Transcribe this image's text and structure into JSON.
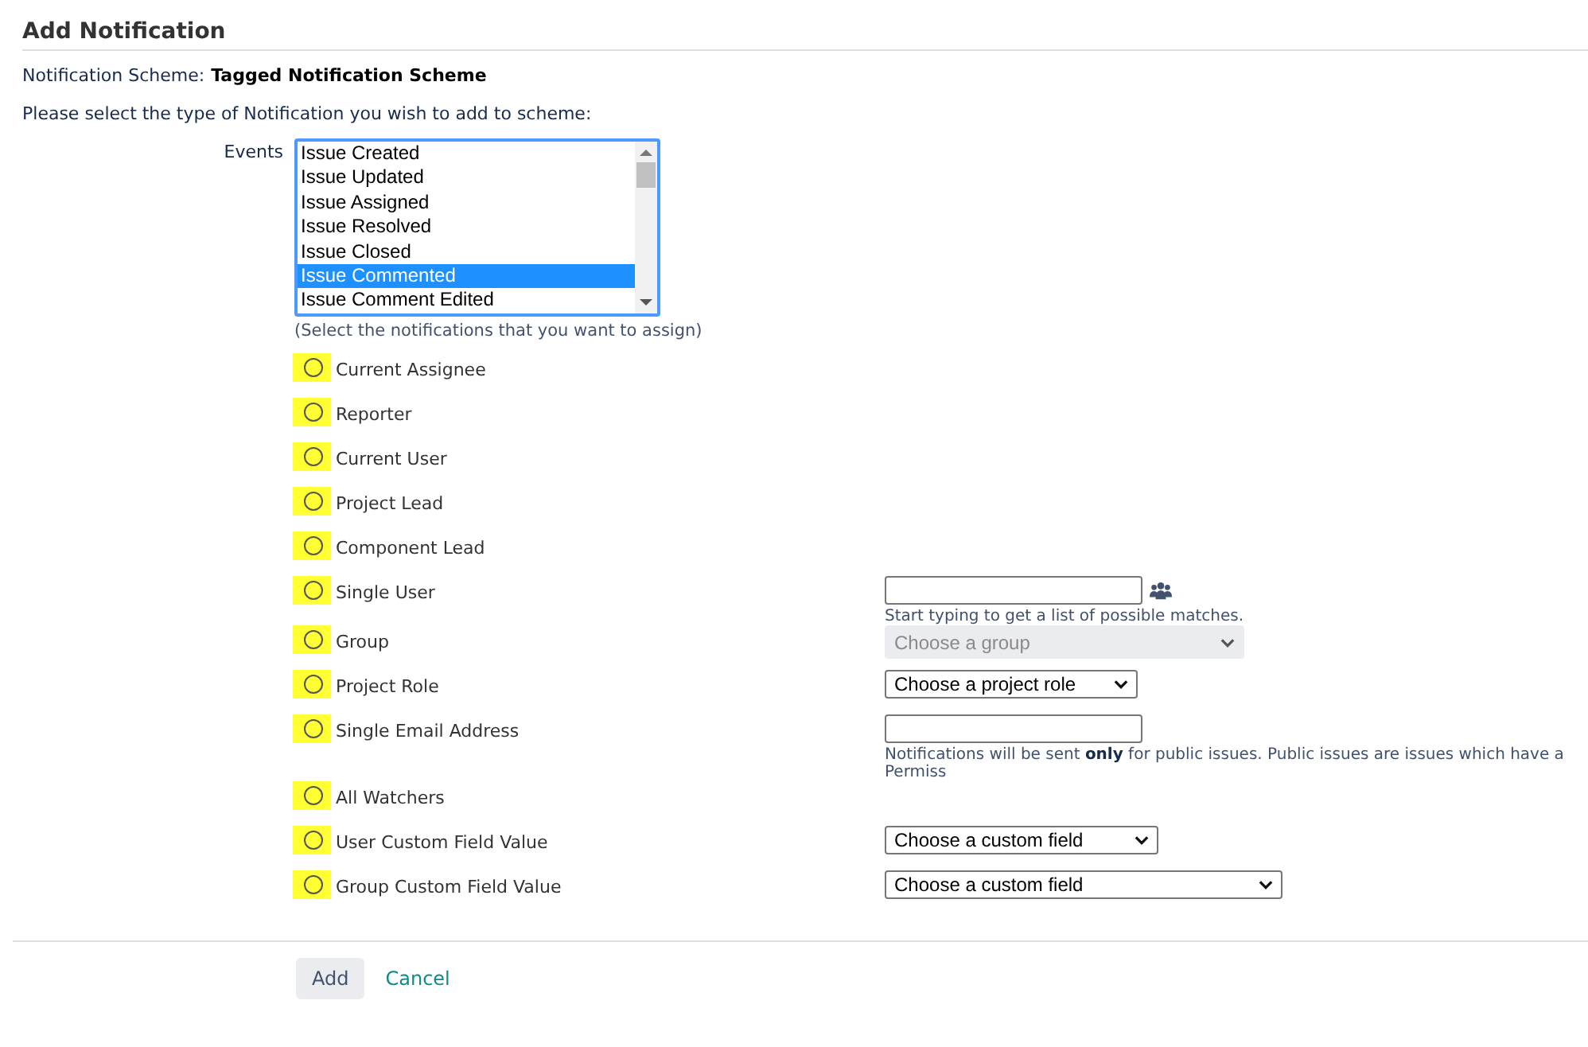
{
  "title": "Add Notification",
  "scheme": {
    "label": "Notification Scheme:",
    "name": "Tagged Notification Scheme"
  },
  "instruction": "Please select the type of Notification you wish to add to scheme:",
  "events": {
    "label": "Events",
    "hint": "(Select the notifications that you want to assign)",
    "items": [
      {
        "label": "Issue Created",
        "selected": false
      },
      {
        "label": "Issue Updated",
        "selected": false
      },
      {
        "label": "Issue Assigned",
        "selected": false
      },
      {
        "label": "Issue Resolved",
        "selected": false
      },
      {
        "label": "Issue Closed",
        "selected": false
      },
      {
        "label": "Issue Commented",
        "selected": true
      },
      {
        "label": "Issue Comment Edited",
        "selected": false
      }
    ]
  },
  "options": [
    {
      "label": "Current Assignee",
      "selected": false,
      "highlighted": true
    },
    {
      "label": "Reporter",
      "selected": false,
      "highlighted": true
    },
    {
      "label": "Current User",
      "selected": false,
      "highlighted": true
    },
    {
      "label": "Project Lead",
      "selected": false,
      "highlighted": true
    },
    {
      "label": "Component Lead",
      "selected": false,
      "highlighted": true
    },
    {
      "label": "Single User",
      "selected": false,
      "highlighted": true,
      "control": {
        "kind": "user-picker",
        "hint": "Start typing to get a list of possible matches."
      }
    },
    {
      "label": "Group",
      "selected": false,
      "highlighted": true,
      "control": {
        "kind": "select",
        "value": "Choose a group",
        "disabled": true
      }
    },
    {
      "label": "Project Role",
      "selected": false,
      "highlighted": true,
      "control": {
        "kind": "select",
        "value": "Choose a project role",
        "disabled": false
      }
    },
    {
      "label": "Single Email Address",
      "selected": false,
      "highlighted": true,
      "control": {
        "kind": "text",
        "hint": "Notifications will be sent **only** for public issues. Public issues are issues which have a Permiss"
      }
    },
    {
      "label": "All Watchers",
      "selected": false,
      "highlighted": true
    },
    {
      "label": "User Custom Field Value",
      "selected": false,
      "highlighted": true,
      "control": {
        "kind": "select",
        "value": "Choose a custom field",
        "disabled": false
      }
    },
    {
      "label": "Group Custom Field Value",
      "selected": false,
      "highlighted": true,
      "control": {
        "kind": "select",
        "value": "Choose a custom field",
        "disabled": false
      }
    }
  ],
  "buttons": {
    "submit": "Add",
    "cancel": "Cancel"
  }
}
